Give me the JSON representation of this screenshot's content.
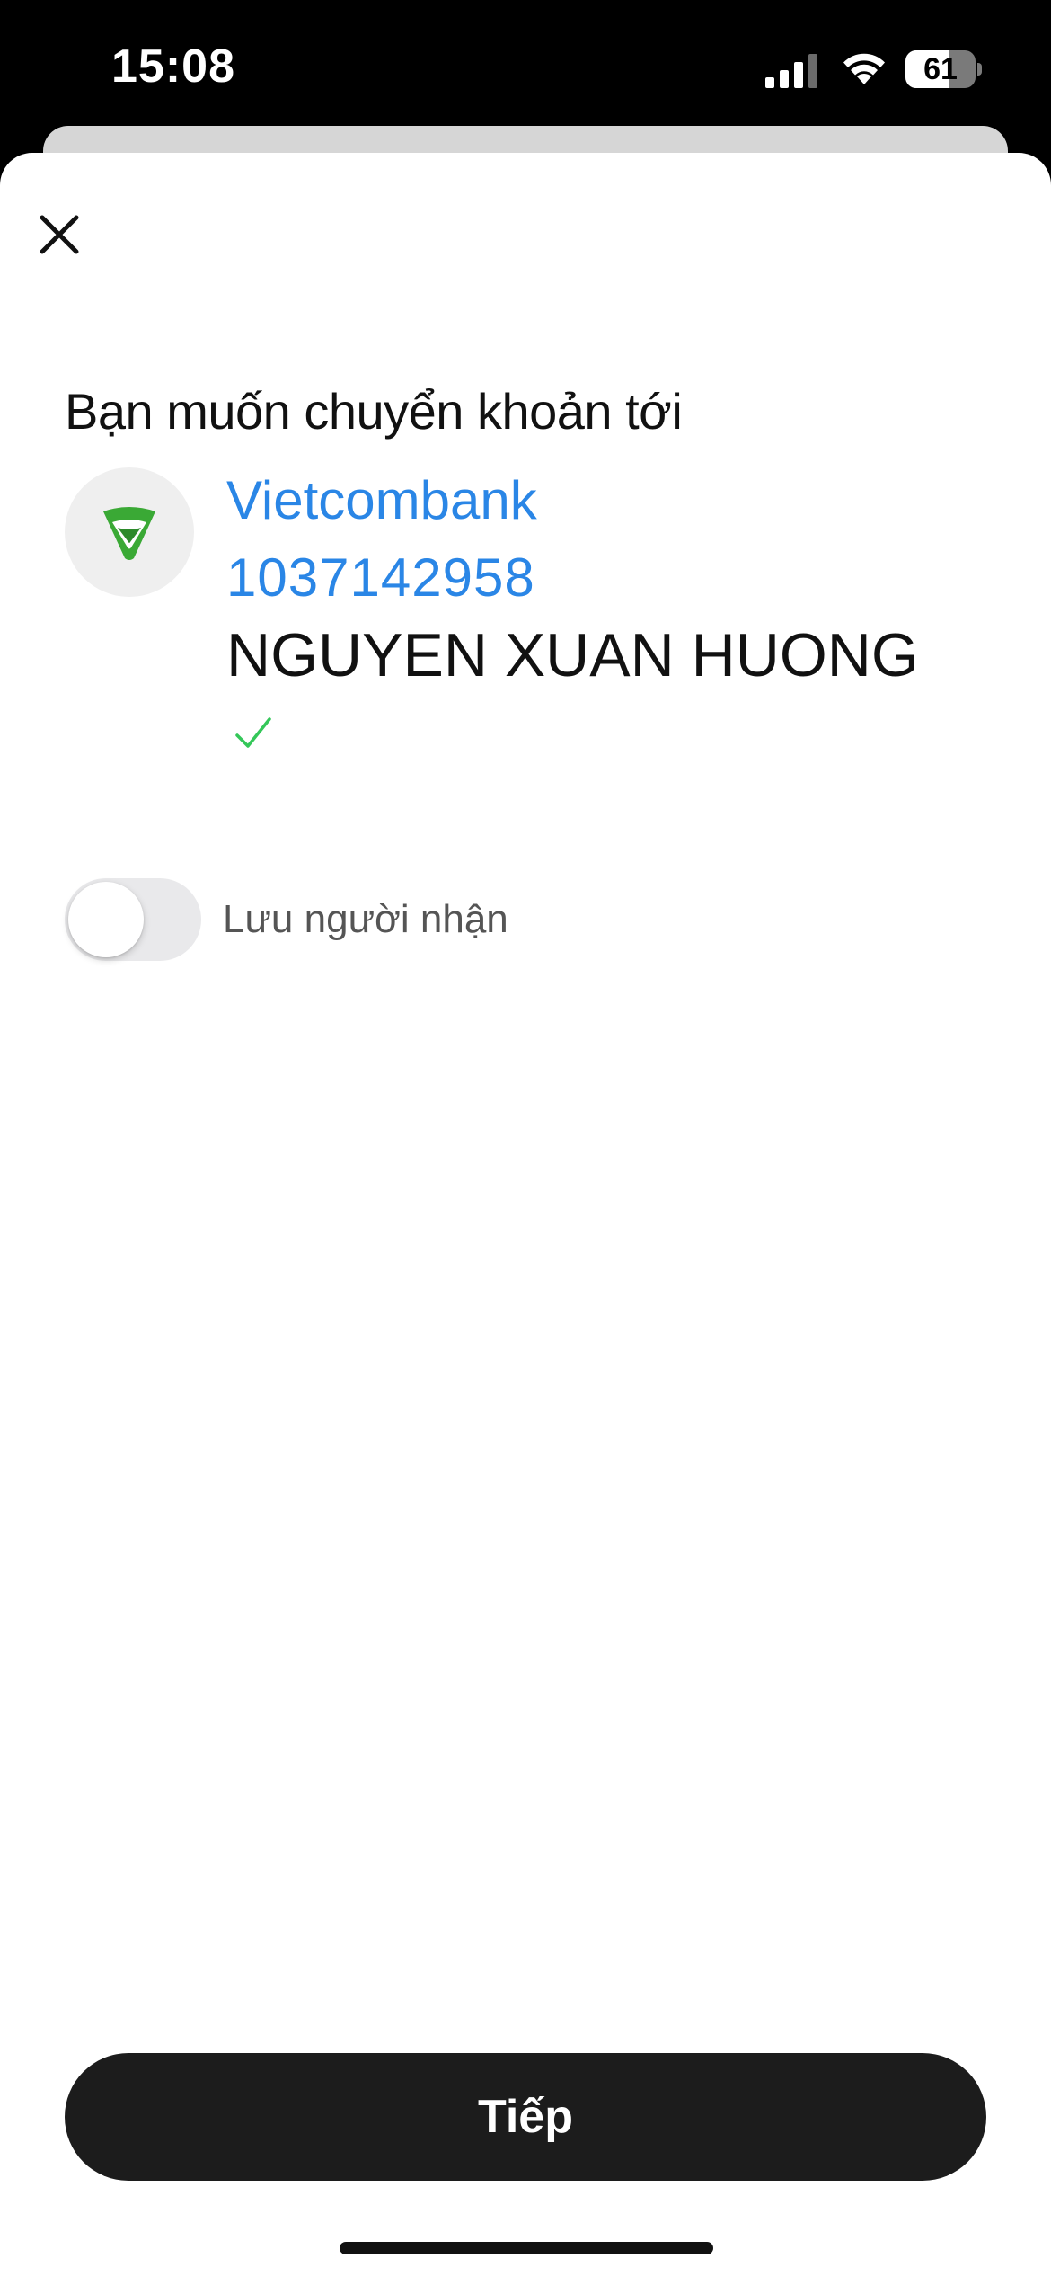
{
  "status_bar": {
    "time": "15:08",
    "battery_level": "61",
    "battery_fraction": 0.61
  },
  "sheet": {
    "close_icon": "close-icon",
    "title": "Bạn muốn chuyển khoản tới",
    "recipient": {
      "bank_name": "Vietcombank",
      "account_number": "1037142958",
      "account_holder": "NGUYEN XUAN HUONG",
      "verified_icon": "checkmark-icon"
    },
    "save_recipient": {
      "label": "Lưu người nhận",
      "enabled": false
    },
    "continue_label": "Tiếp"
  },
  "colors": {
    "link_blue": "#2a86e6",
    "verified_green": "#34c759",
    "bank_green": "#3aa935",
    "button_dark": "#1c1c1c"
  }
}
